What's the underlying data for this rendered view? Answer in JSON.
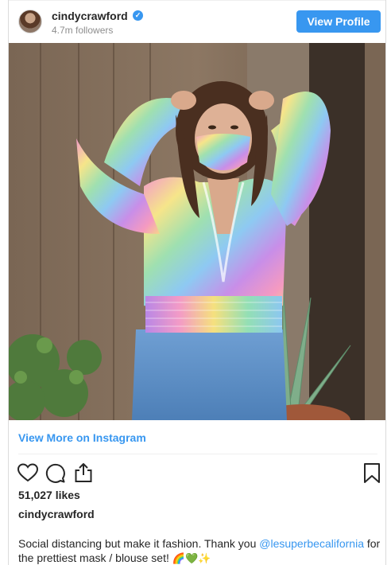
{
  "header": {
    "username": "cindycrawford",
    "verified_icon": "verified-badge-icon",
    "followers": "4.7m followers",
    "view_profile_label": "View Profile"
  },
  "post": {
    "image_alt": "Woman in rainbow print blouse and matching face mask, wearing jeans, standing in front of a wooden wall with succulent plants",
    "view_more_label": "View More on Instagram",
    "likes": "51,027 likes",
    "owner": "cindycrawford",
    "caption_text_1": "Social distancing but make it fashion. Thank you ",
    "caption_mention": "@lesuperbecalifornia",
    "caption_text_2": " for the prettiest mask / blouse set! ",
    "caption_emojis": "🌈💚✨"
  },
  "icons": {
    "like": "heart-icon",
    "comment": "comment-bubble-icon",
    "share": "share-upload-icon",
    "save": "bookmark-icon"
  },
  "colors": {
    "accent": "#3897f0",
    "text": "#262626",
    "muted": "#8e8e8e",
    "border": "#dbdbdb"
  }
}
